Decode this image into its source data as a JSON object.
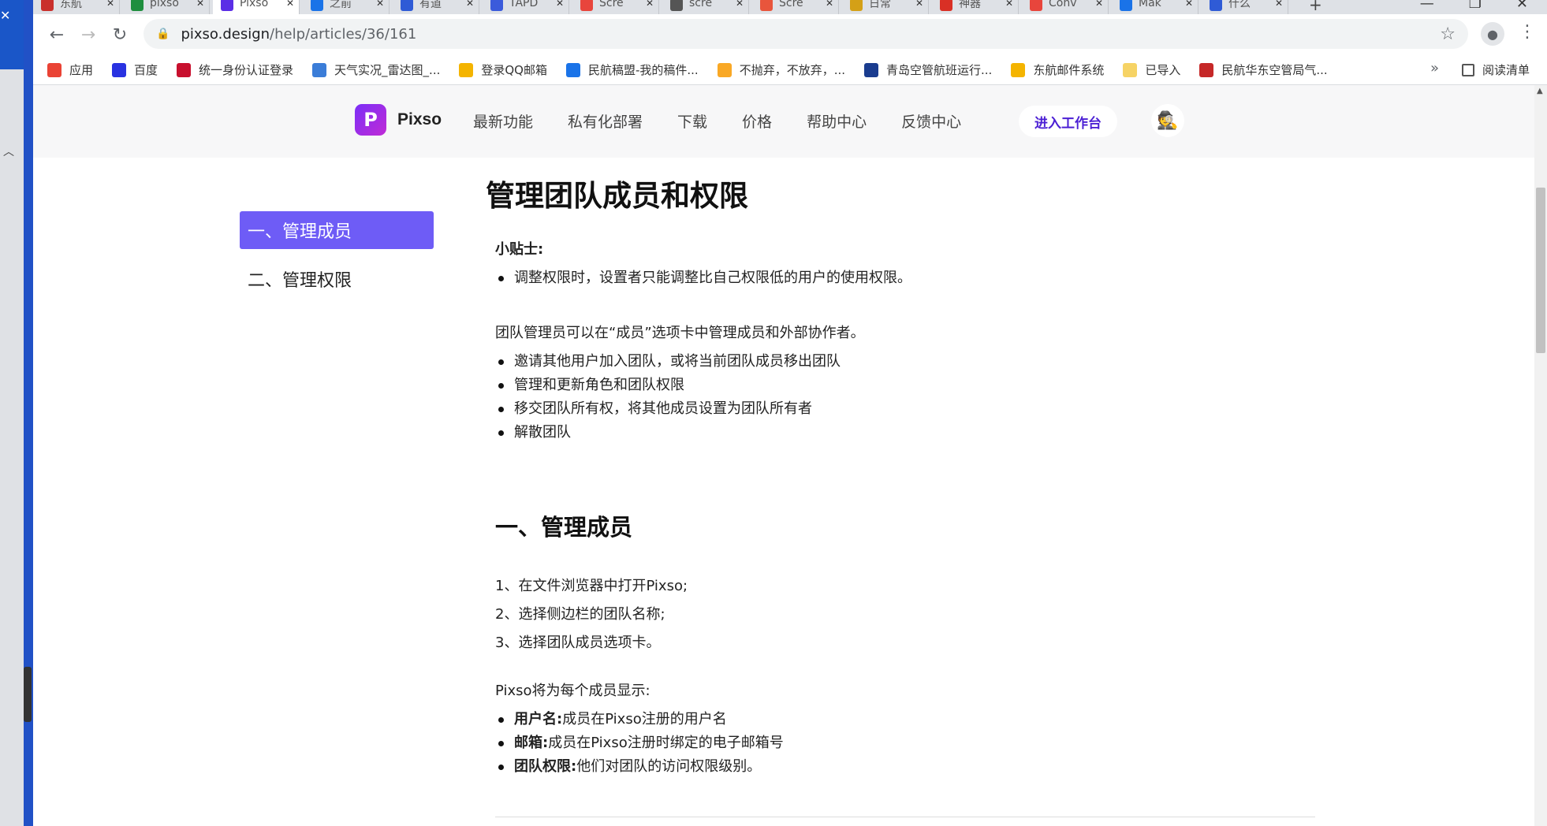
{
  "browser": {
    "tabs": [
      {
        "label": "东航",
        "color": "#c9302c"
      },
      {
        "label": "pixso",
        "color": "#1e8e3e"
      },
      {
        "label": "Pixso",
        "color": "#5b2ee6",
        "active": true
      },
      {
        "label": "之前",
        "color": "#1a73e8"
      },
      {
        "label": "有道",
        "color": "#2f5bd6"
      },
      {
        "label": "TAPD",
        "color": "#3b5bdb"
      },
      {
        "label": "Scre",
        "color": "#e8453c"
      },
      {
        "label": "scre",
        "color": "#555555"
      },
      {
        "label": "Scre",
        "color": "#e8553c"
      },
      {
        "label": "日常",
        "color": "#d4a017"
      },
      {
        "label": "神器",
        "color": "#d93025"
      },
      {
        "label": "Conv",
        "color": "#e8453c"
      },
      {
        "label": "Mak",
        "color": "#1a73e8"
      },
      {
        "label": "什么",
        "color": "#2f5bd6"
      }
    ],
    "new_tab": "+",
    "address": {
      "host": "pixso.design",
      "path": "/help/articles/36/161"
    },
    "nav": {
      "back": "←",
      "forward": "→",
      "reload": "↻",
      "star": "☆",
      "menu": "⋮"
    },
    "bookmarks": [
      {
        "label": "应用",
        "color": "#ea4335"
      },
      {
        "label": "百度",
        "color": "#2932e1"
      },
      {
        "label": "统一身份认证登录",
        "color": "#c8102e"
      },
      {
        "label": "天气实况_雷达图_...",
        "color": "#3b7dd8"
      },
      {
        "label": "登录QQ邮箱",
        "color": "#f4b400"
      },
      {
        "label": "民航稿盟-我的稿件...",
        "color": "#1a73e8"
      },
      {
        "label": "不抛弃，不放弃，...",
        "color": "#f9a825"
      },
      {
        "label": "青岛空管航班运行...",
        "color": "#1a3c8f"
      },
      {
        "label": "东航邮件系统",
        "color": "#f4b400"
      },
      {
        "label": "已导入",
        "color": "#f6d365"
      },
      {
        "label": "民航华东空管局气...",
        "color": "#c62828"
      }
    ],
    "bookmarks_more": "»",
    "reading_list": "阅读清单"
  },
  "site": {
    "logo_mark": "P",
    "logo_name": "Pixso",
    "nav": [
      "最新功能",
      "私有化部署",
      "下载",
      "价格",
      "帮助中心",
      "反馈中心"
    ],
    "cta": "进入工作台"
  },
  "toc": [
    "一、管理成员",
    "二、管理权限"
  ],
  "article": {
    "title": "管理团队成员和权限",
    "tip_label": "小贴士:",
    "tips": [
      "调整权限时，设置者只能调整比自己权限低的用户的使用权限。"
    ],
    "intro": "团队管理员可以在“成员”选项卡中管理成员和外部协作者。",
    "capabilities": [
      "邀请其他用户加入团队，或将当前团队成员移出团队",
      "管理和更新角色和团队权限",
      "移交团队所有权，将其他成员设置为团队所有者",
      "解散团队"
    ],
    "section1_title": "一、管理成员",
    "steps": [
      "1、在文件浏览器中打开Pixso;",
      "2、选择侧边栏的团队名称;",
      "3、选择团队成员选项卡。"
    ],
    "display_intro": "Pixso将为每个成员显示:",
    "fields": [
      {
        "key": "用户名:",
        "value": "成员在Pixso注册的用户名"
      },
      {
        "key": "邮箱:",
        "value": "成员在Pixso注册时绑定的电子邮箱号"
      },
      {
        "key": "团队权限:",
        "value": "他们对团队的访问权限级别。"
      }
    ]
  }
}
